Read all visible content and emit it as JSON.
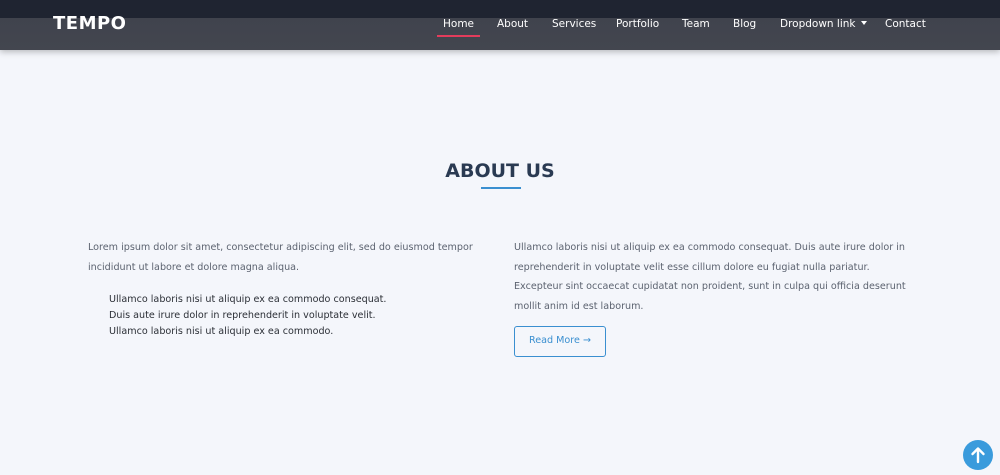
{
  "header": {
    "logo": "TEMPO",
    "nav": [
      {
        "label": "Home",
        "active": true
      },
      {
        "label": "About"
      },
      {
        "label": "Services"
      },
      {
        "label": "Portfolio"
      },
      {
        "label": "Team"
      },
      {
        "label": "Blog"
      },
      {
        "label": "Dropdown link",
        "icon": "caret-down-icon"
      },
      {
        "label": "Contact"
      }
    ],
    "active_color": "#e43c5c"
  },
  "about": {
    "title": "ABOUT US",
    "left_paragraph": "Lorem ipsum dolor sit amet, consectetur adipiscing elit, sed do eiusmod tempor incididunt ut labore et dolore magna aliqua.",
    "list": [
      "Ullamco laboris nisi ut aliquip ex ea commodo consequat.",
      "Duis aute irure dolor in reprehenderit in voluptate velit.",
      "Ullamco laboris nisi ut aliquip ex ea commodo."
    ],
    "right_paragraph": "Ullamco laboris nisi ut aliquip ex ea commodo consequat. Duis aute irure dolor in reprehenderit in voluptate velit esse cillum dolore eu fugiat nulla pariatur. Excepteur sint occaecat cupidatat non proident, sunt in culpa qui officia deserunt mollit anim id est laborum.",
    "button_label": "Read More →",
    "accent_color": "#3a8fd0"
  },
  "back_to_top": {
    "icon": "arrow-up-icon"
  }
}
